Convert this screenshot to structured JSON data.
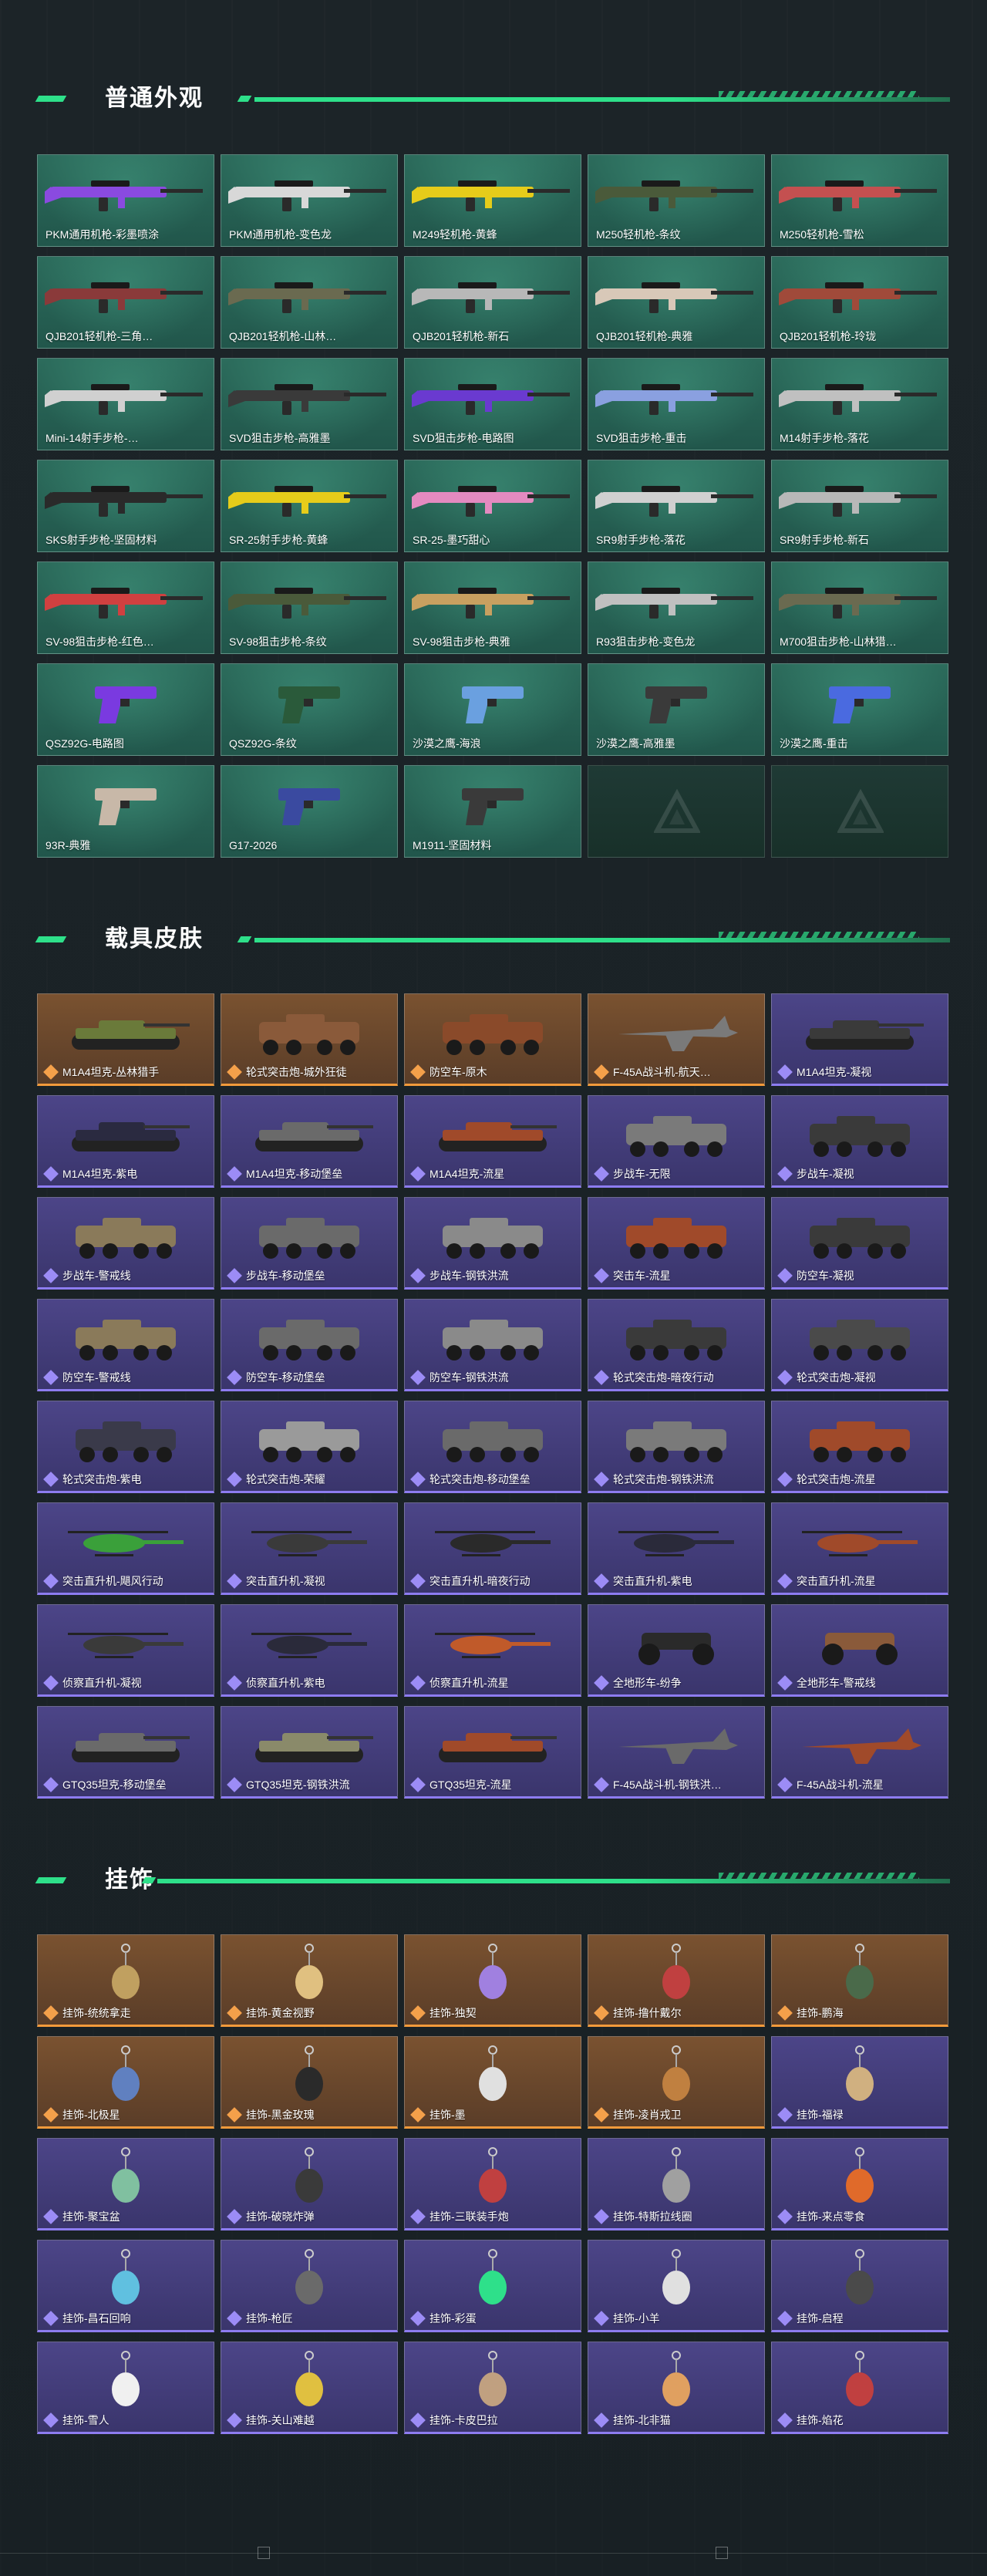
{
  "sections": {
    "weapons": {
      "title": "普通外观",
      "items": [
        {
          "label": "PKM通用机枪-彩墨喷涂",
          "color": "#8a4ae0"
        },
        {
          "label": "PKM通用机枪-变色龙",
          "color": "#d8d8d8"
        },
        {
          "label": "M249轻机枪-黄蜂",
          "color": "#e6cc1a"
        },
        {
          "label": "M250轻机枪-条纹",
          "color": "#4a5a3a"
        },
        {
          "label": "M250轻机枪-雪松",
          "color": "#c45050"
        },
        {
          "label": "QJB201轻机枪-三角…",
          "color": "#8a3a3a"
        },
        {
          "label": "QJB201轻机枪-山林…",
          "color": "#6a6a50"
        },
        {
          "label": "QJB201轻机枪-新石",
          "color": "#b8b8b8"
        },
        {
          "label": "QJB201轻机枪-典雅",
          "color": "#d8c8b8"
        },
        {
          "label": "QJB201轻机枪-玲珑",
          "color": "#a04a3a"
        },
        {
          "label": "Mini-14射手步枪-…",
          "color": "#d0d0d0"
        },
        {
          "label": "SVD狙击步枪-高雅墨",
          "color": "#3a3a3a"
        },
        {
          "label": "SVD狙击步枪-电路图",
          "color": "#6a3ad0"
        },
        {
          "label": "SVD狙击步枪-重击",
          "color": "#8aa0e0"
        },
        {
          "label": "M14射手步枪-落花",
          "color": "#c0c0c0"
        },
        {
          "label": "SKS射手步枪-坚固材料",
          "color": "#2a2a2a"
        },
        {
          "label": "SR-25射手步枪-黄蜂",
          "color": "#e6cc1a"
        },
        {
          "label": "SR-25-墨巧甜心",
          "color": "#e48ac0"
        },
        {
          "label": "SR9射手步枪-落花",
          "color": "#d0d0d0"
        },
        {
          "label": "SR9射手步枪-新石",
          "color": "#b8b8b8"
        },
        {
          "label": "SV-98狙击步枪-红色…",
          "color": "#d04040"
        },
        {
          "label": "SV-98狙击步枪-条纹",
          "color": "#4a5a3a"
        },
        {
          "label": "SV-98狙击步枪-典雅",
          "color": "#c8a060"
        },
        {
          "label": "R93狙击步枪-变色龙",
          "color": "#c0c0c0"
        },
        {
          "label": "M700狙击步枪-山林猎…",
          "color": "#6a6a50"
        },
        {
          "label": "QSZ92G-电路图",
          "color": "#7a3ae0"
        },
        {
          "label": "QSZ92G-条纹",
          "color": "#2a5a3a"
        },
        {
          "label": "沙漠之鹰-海浪",
          "color": "#6aa0e0"
        },
        {
          "label": "沙漠之鹰-高雅墨",
          "color": "#3a3a3a"
        },
        {
          "label": "沙漠之鹰-重击",
          "color": "#4a6ae0"
        },
        {
          "label": "93R-典雅",
          "color": "#c8b8a8"
        },
        {
          "label": "G17-2026",
          "color": "#3a4aa0"
        },
        {
          "label": "M1911-坚固材料",
          "color": "#3a3a3a"
        },
        {
          "label": "",
          "color": ""
        },
        {
          "label": "",
          "color": ""
        }
      ]
    },
    "vehicles": {
      "title": "载具皮肤",
      "items": [
        {
          "label": "M1A4坦克-丛林猎手",
          "rarity": "orange",
          "kind": "tank",
          "color": "#6a7a3a"
        },
        {
          "label": "轮式突击炮-城外狂徒",
          "rarity": "orange",
          "kind": "apc",
          "color": "#8a5a3a"
        },
        {
          "label": "防空车-原木",
          "rarity": "orange",
          "kind": "apc",
          "color": "#8a4a2a"
        },
        {
          "label": "F-45A战斗机-航天…",
          "rarity": "orange",
          "kind": "jet",
          "color": "#7a7a7a"
        },
        {
          "label": "M1A4坦克-凝视",
          "rarity": "purple",
          "kind": "tank",
          "color": "#3a3a3a"
        },
        {
          "label": "M1A4坦克-紫电",
          "rarity": "purple",
          "kind": "tank",
          "color": "#2a2a40"
        },
        {
          "label": "M1A4坦克-移动堡垒",
          "rarity": "purple",
          "kind": "tank",
          "color": "#6a6a6a"
        },
        {
          "label": "M1A4坦克-流星",
          "rarity": "purple",
          "kind": "tank",
          "color": "#a04a2a"
        },
        {
          "label": "步战车-无限",
          "rarity": "purple",
          "kind": "apc",
          "color": "#7a7a7a"
        },
        {
          "label": "步战车-凝视",
          "rarity": "purple",
          "kind": "apc",
          "color": "#3a3a3a"
        },
        {
          "label": "步战车-警戒线",
          "rarity": "purple",
          "kind": "apc",
          "color": "#8a7a5a"
        },
        {
          "label": "步战车-移动堡垒",
          "rarity": "purple",
          "kind": "apc",
          "color": "#6a6a6a"
        },
        {
          "label": "步战车-钢铁洪流",
          "rarity": "purple",
          "kind": "apc",
          "color": "#8a8a8a"
        },
        {
          "label": "突击车-流星",
          "rarity": "purple",
          "kind": "truck",
          "color": "#a04a2a"
        },
        {
          "label": "防空车-凝视",
          "rarity": "purple",
          "kind": "apc",
          "color": "#3a3a3a"
        },
        {
          "label": "防空车-警戒线",
          "rarity": "purple",
          "kind": "apc",
          "color": "#8a7a5a"
        },
        {
          "label": "防空车-移动堡垒",
          "rarity": "purple",
          "kind": "apc",
          "color": "#6a6a6a"
        },
        {
          "label": "防空车-钢铁洪流",
          "rarity": "purple",
          "kind": "apc",
          "color": "#8a8a8a"
        },
        {
          "label": "轮式突击炮-暗夜行动",
          "rarity": "purple",
          "kind": "truck",
          "color": "#3a3a3a"
        },
        {
          "label": "轮式突击炮-凝视",
          "rarity": "purple",
          "kind": "truck",
          "color": "#4a4a4a"
        },
        {
          "label": "轮式突击炮-紫电",
          "rarity": "purple",
          "kind": "truck",
          "color": "#3a3a4a"
        },
        {
          "label": "轮式突击炮-荣耀",
          "rarity": "purple",
          "kind": "truck",
          "color": "#9a9a9a"
        },
        {
          "label": "轮式突击炮-移动堡垒",
          "rarity": "purple",
          "kind": "truck",
          "color": "#6a6a6a"
        },
        {
          "label": "轮式突击炮-钢铁洪流",
          "rarity": "purple",
          "kind": "truck",
          "color": "#7a7a7a"
        },
        {
          "label": "轮式突击炮-流星",
          "rarity": "purple",
          "kind": "truck",
          "color": "#a04a2a"
        },
        {
          "label": "突击直升机-飓风行动",
          "rarity": "purple",
          "kind": "heli",
          "color": "#3aa03a"
        },
        {
          "label": "突击直升机-凝视",
          "rarity": "purple",
          "kind": "heli",
          "color": "#3a3a3a"
        },
        {
          "label": "突击直升机-暗夜行动",
          "rarity": "purple",
          "kind": "heli",
          "color": "#2a2a2a"
        },
        {
          "label": "突击直升机-紫电",
          "rarity": "purple",
          "kind": "heli",
          "color": "#2a2a3a"
        },
        {
          "label": "突击直升机-流星",
          "rarity": "purple",
          "kind": "heli",
          "color": "#a04a2a"
        },
        {
          "label": "侦察直升机-凝视",
          "rarity": "purple",
          "kind": "heli",
          "color": "#3a3a3a"
        },
        {
          "label": "侦察直升机-紫电",
          "rarity": "purple",
          "kind": "heli",
          "color": "#2a2a3a"
        },
        {
          "label": "侦察直升机-流星",
          "rarity": "purple",
          "kind": "heli",
          "color": "#c05a2a"
        },
        {
          "label": "全地形车-纷争",
          "rarity": "purple",
          "kind": "atv",
          "color": "#2a2a2a"
        },
        {
          "label": "全地形车-警戒线",
          "rarity": "purple",
          "kind": "atv",
          "color": "#8a5a3a"
        },
        {
          "label": "GTQ35坦克-移动堡垒",
          "rarity": "purple",
          "kind": "tank",
          "color": "#6a6a6a"
        },
        {
          "label": "GTQ35坦克-钢铁洪流",
          "rarity": "purple",
          "kind": "tank",
          "color": "#8a8a6a"
        },
        {
          "label": "GTQ35坦克-流星",
          "rarity": "purple",
          "kind": "tank",
          "color": "#a04a2a"
        },
        {
          "label": "F-45A战斗机-钢铁洪…",
          "rarity": "purple",
          "kind": "jet",
          "color": "#6a6a6a"
        },
        {
          "label": "F-45A战斗机-流星",
          "rarity": "purple",
          "kind": "jet",
          "color": "#a04a2a"
        }
      ]
    },
    "charms": {
      "title": "挂饰",
      "items": [
        {
          "label": "挂饰-统统拿走",
          "rarity": "orange",
          "color": "#c0a060"
        },
        {
          "label": "挂饰-黄金视野",
          "rarity": "orange",
          "color": "#e0c080"
        },
        {
          "label": "挂饰-独契",
          "rarity": "orange",
          "color": "#a080e0"
        },
        {
          "label": "挂饰-撸什戴尔",
          "rarity": "orange",
          "color": "#c04040"
        },
        {
          "label": "挂饰-鹏海",
          "rarity": "orange",
          "color": "#4a6a4a"
        },
        {
          "label": "挂饰-北极星",
          "rarity": "orange",
          "color": "#6080c0"
        },
        {
          "label": "挂饰-黑金玫瑰",
          "rarity": "orange",
          "color": "#2a2a2a"
        },
        {
          "label": "挂饰-墨",
          "rarity": "orange",
          "color": "#e0e0e0"
        },
        {
          "label": "挂饰-凌肖戎卫",
          "rarity": "orange",
          "color": "#c08040"
        },
        {
          "label": "挂饰-福禄",
          "rarity": "purple",
          "color": "#d0b080"
        },
        {
          "label": "挂饰-聚宝盆",
          "rarity": "purple",
          "color": "#80c0a0"
        },
        {
          "label": "挂饰-破晓炸弹",
          "rarity": "purple",
          "color": "#3a3a3a"
        },
        {
          "label": "挂饰-三联装手炮",
          "rarity": "purple",
          "color": "#c04040"
        },
        {
          "label": "挂饰-特斯拉线圈",
          "rarity": "purple",
          "color": "#a0a0a0"
        },
        {
          "label": "挂饰-来点零食",
          "rarity": "purple",
          "color": "#e06a2a"
        },
        {
          "label": "挂饰-昌石回响",
          "rarity": "purple",
          "color": "#60c0e0"
        },
        {
          "label": "挂饰-枪匠",
          "rarity": "purple",
          "color": "#6a6a6a"
        },
        {
          "label": "挂饰-彩蛋",
          "rarity": "purple",
          "color": "#2ee08a"
        },
        {
          "label": "挂饰-小羊",
          "rarity": "purple",
          "color": "#e0e0e0"
        },
        {
          "label": "挂饰-启程",
          "rarity": "purple",
          "color": "#4a4a4a"
        },
        {
          "label": "挂饰-雪人",
          "rarity": "purple",
          "color": "#f0f0f0"
        },
        {
          "label": "挂饰-关山难越",
          "rarity": "purple",
          "color": "#e0c040"
        },
        {
          "label": "挂饰-卡皮巴拉",
          "rarity": "purple",
          "color": "#c0a080"
        },
        {
          "label": "挂饰-北非猫",
          "rarity": "purple",
          "color": "#e0a060"
        },
        {
          "label": "挂饰-焰花",
          "rarity": "purple",
          "color": "#c04040"
        }
      ]
    }
  }
}
